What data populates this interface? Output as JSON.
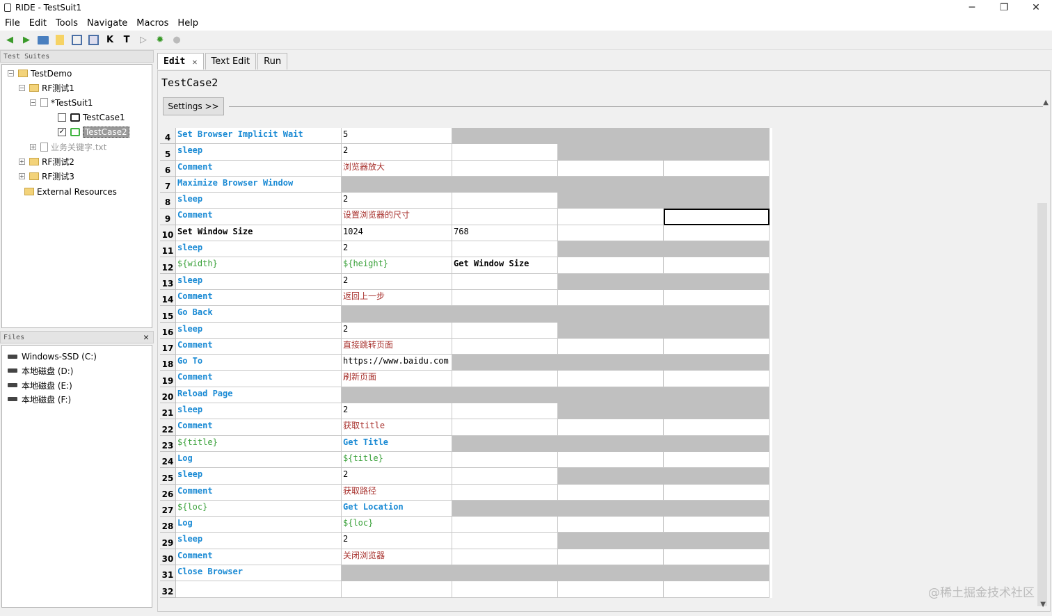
{
  "window": {
    "title": "RIDE - TestSuit1",
    "min": "─",
    "max": "❐",
    "close": "✕"
  },
  "menu": [
    "File",
    "Edit",
    "Tools",
    "Navigate",
    "Macros",
    "Help"
  ],
  "toolbar": {
    "k_label": "K",
    "t_label": "T"
  },
  "test_suites": {
    "header": "Test Suites",
    "items": {
      "root": "TestDemo",
      "rf1": "RF测试1",
      "suit1": "*TestSuit1",
      "tc1": "TestCase1",
      "tc2": "TestCase2",
      "business": "业务关键字.txt",
      "rf2": "RF测试2",
      "rf3": "RF测试3",
      "external": "External Resources"
    }
  },
  "files": {
    "header": "Files",
    "drives": [
      "Windows-SSD (C:)",
      "本地磁盘 (D:)",
      "本地磁盘 (E:)",
      "本地磁盘 (F:)"
    ]
  },
  "tabs": {
    "edit": "Edit",
    "text_edit": "Text Edit",
    "run": "Run"
  },
  "editor": {
    "title": "TestCase2",
    "settings": "Settings >>"
  },
  "rows": [
    {
      "n": "4",
      "c": [
        [
          "Set Browser Implicit Wait",
          "kw"
        ],
        [
          "5",
          "num"
        ],
        [
          "",
          "g"
        ],
        [
          "",
          "g"
        ],
        [
          "",
          "g"
        ]
      ]
    },
    {
      "n": "5",
      "c": [
        [
          "sleep",
          "kw"
        ],
        [
          "2",
          "num"
        ],
        [
          "",
          ""
        ],
        [
          "",
          "g"
        ],
        [
          "",
          "g"
        ]
      ]
    },
    {
      "n": "6",
      "c": [
        [
          "Comment",
          "kw"
        ],
        [
          "浏览器放大",
          "cmt"
        ],
        [
          "",
          ""
        ],
        [
          "",
          ""
        ],
        [
          "",
          ""
        ]
      ]
    },
    {
      "n": "7",
      "c": [
        [
          "Maximize Browser Window",
          "kw"
        ],
        [
          "",
          "g"
        ],
        [
          "",
          "g"
        ],
        [
          "",
          "g"
        ],
        [
          "",
          "g"
        ]
      ]
    },
    {
      "n": "8",
      "c": [
        [
          "sleep",
          "kw"
        ],
        [
          "2",
          "num"
        ],
        [
          "",
          ""
        ],
        [
          "",
          "g"
        ],
        [
          "",
          "g"
        ]
      ]
    },
    {
      "n": "9",
      "c": [
        [
          "Comment",
          "kw"
        ],
        [
          "设置浏览器的尺寸",
          "cmt"
        ],
        [
          "",
          ""
        ],
        [
          "",
          ""
        ],
        [
          "",
          "sel"
        ]
      ]
    },
    {
      "n": "10",
      "c": [
        [
          "Set Window Size",
          "kwb"
        ],
        [
          "1024",
          "num"
        ],
        [
          "768",
          "num"
        ],
        [
          "",
          ""
        ],
        [
          "",
          ""
        ]
      ]
    },
    {
      "n": "11",
      "c": [
        [
          "sleep",
          "kw"
        ],
        [
          "2",
          "num"
        ],
        [
          "",
          ""
        ],
        [
          "",
          "g"
        ],
        [
          "",
          "g"
        ]
      ]
    },
    {
      "n": "12",
      "c": [
        [
          "${width}",
          "var"
        ],
        [
          "${height}",
          "var"
        ],
        [
          "Get Window Size",
          "kwb"
        ],
        [
          "",
          ""
        ],
        [
          "",
          ""
        ]
      ]
    },
    {
      "n": "13",
      "c": [
        [
          "sleep",
          "kw"
        ],
        [
          "2",
          "num"
        ],
        [
          "",
          ""
        ],
        [
          "",
          "g"
        ],
        [
          "",
          "g"
        ]
      ]
    },
    {
      "n": "14",
      "c": [
        [
          "Comment",
          "kw"
        ],
        [
          "返回上一步",
          "cmt"
        ],
        [
          "",
          ""
        ],
        [
          "",
          ""
        ],
        [
          "",
          ""
        ]
      ]
    },
    {
      "n": "15",
      "c": [
        [
          "Go Back",
          "kw"
        ],
        [
          "",
          "g"
        ],
        [
          "",
          "g"
        ],
        [
          "",
          "g"
        ],
        [
          "",
          "g"
        ]
      ]
    },
    {
      "n": "16",
      "c": [
        [
          "sleep",
          "kw"
        ],
        [
          "2",
          "num"
        ],
        [
          "",
          ""
        ],
        [
          "",
          "g"
        ],
        [
          "",
          "g"
        ]
      ]
    },
    {
      "n": "17",
      "c": [
        [
          "Comment",
          "kw"
        ],
        [
          "直接跳转页面",
          "cmt"
        ],
        [
          "",
          ""
        ],
        [
          "",
          ""
        ],
        [
          "",
          ""
        ]
      ]
    },
    {
      "n": "18",
      "c": [
        [
          "Go To",
          "kw"
        ],
        [
          "https://www.baidu.com",
          "num"
        ],
        [
          "",
          "g"
        ],
        [
          "",
          "g"
        ],
        [
          "",
          "g"
        ]
      ]
    },
    {
      "n": "19",
      "c": [
        [
          "Comment",
          "kw"
        ],
        [
          "刷新页面",
          "cmt"
        ],
        [
          "",
          ""
        ],
        [
          "",
          ""
        ],
        [
          "",
          ""
        ]
      ]
    },
    {
      "n": "20",
      "c": [
        [
          "Reload Page",
          "kw"
        ],
        [
          "",
          "g"
        ],
        [
          "",
          "g"
        ],
        [
          "",
          "g"
        ],
        [
          "",
          "g"
        ]
      ]
    },
    {
      "n": "21",
      "c": [
        [
          "sleep",
          "kw"
        ],
        [
          "2",
          "num"
        ],
        [
          "",
          ""
        ],
        [
          "",
          "g"
        ],
        [
          "",
          "g"
        ]
      ]
    },
    {
      "n": "22",
      "c": [
        [
          "Comment",
          "kw"
        ],
        [
          "获取title",
          "cmt"
        ],
        [
          "",
          ""
        ],
        [
          "",
          ""
        ],
        [
          "",
          ""
        ]
      ]
    },
    {
      "n": "23",
      "c": [
        [
          "${title}",
          "var"
        ],
        [
          "Get Title",
          "kw"
        ],
        [
          "",
          "g"
        ],
        [
          "",
          "g"
        ],
        [
          "",
          "g"
        ]
      ]
    },
    {
      "n": "24",
      "c": [
        [
          "Log",
          "kw"
        ],
        [
          "${title}",
          "var"
        ],
        [
          "",
          ""
        ],
        [
          "",
          ""
        ],
        [
          "",
          ""
        ]
      ]
    },
    {
      "n": "25",
      "c": [
        [
          "sleep",
          "kw"
        ],
        [
          "2",
          "num"
        ],
        [
          "",
          ""
        ],
        [
          "",
          "g"
        ],
        [
          "",
          "g"
        ]
      ]
    },
    {
      "n": "26",
      "c": [
        [
          "Comment",
          "kw"
        ],
        [
          "获取路径",
          "cmt"
        ],
        [
          "",
          ""
        ],
        [
          "",
          ""
        ],
        [
          "",
          ""
        ]
      ]
    },
    {
      "n": "27",
      "c": [
        [
          "${loc}",
          "var"
        ],
        [
          "Get Location",
          "kw"
        ],
        [
          "",
          "g"
        ],
        [
          "",
          "g"
        ],
        [
          "",
          "g"
        ]
      ]
    },
    {
      "n": "28",
      "c": [
        [
          "Log",
          "kw"
        ],
        [
          "${loc}",
          "var"
        ],
        [
          "",
          ""
        ],
        [
          "",
          ""
        ],
        [
          "",
          ""
        ]
      ]
    },
    {
      "n": "29",
      "c": [
        [
          "sleep",
          "kw"
        ],
        [
          "2",
          "num"
        ],
        [
          "",
          ""
        ],
        [
          "",
          "g"
        ],
        [
          "",
          "g"
        ]
      ]
    },
    {
      "n": "30",
      "c": [
        [
          "Comment",
          "kw"
        ],
        [
          "关闭浏览器",
          "cmt"
        ],
        [
          "",
          ""
        ],
        [
          "",
          ""
        ],
        [
          "",
          ""
        ]
      ]
    },
    {
      "n": "31",
      "c": [
        [
          "Close Browser",
          "kw"
        ],
        [
          "",
          "g"
        ],
        [
          "",
          "g"
        ],
        [
          "",
          "g"
        ],
        [
          "",
          "g"
        ]
      ]
    },
    {
      "n": "32",
      "c": [
        [
          "",
          ""
        ],
        [
          "",
          ""
        ],
        [
          "",
          ""
        ],
        [
          "",
          ""
        ],
        [
          "",
          ""
        ]
      ]
    }
  ],
  "watermark": "@稀土掘金技术社区"
}
